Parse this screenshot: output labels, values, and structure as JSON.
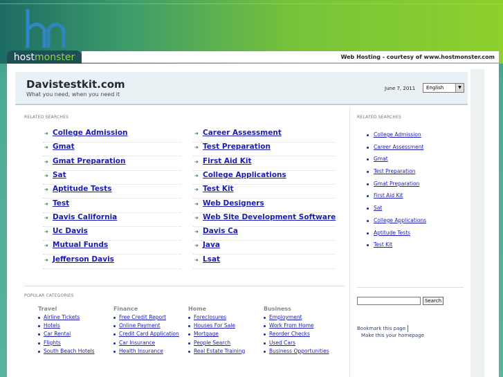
{
  "brand": {
    "host": "host",
    "monster": "monster"
  },
  "courtesy": "Web Hosting - courtesy of www.hostmonster.com",
  "header": {
    "title": "Davistestkit.com",
    "tagline": "What you need, when you need it",
    "date": "June 7, 2011",
    "language": "English"
  },
  "related_label": "RELATED SEARCHES",
  "keywords": [
    "College Admission",
    "Career Assessment",
    "Gmat",
    "Test Preparation",
    "Gmat Preparation",
    "First Aid Kit",
    "Sat",
    "College Applications",
    "Aptitude Tests",
    "Test Kit",
    "Test",
    "Web Designers",
    "Davis California",
    "Web Site Development Software",
    "Uc Davis",
    "Davis Ca",
    "Mutual Funds",
    "Java",
    "Jefferson Davis",
    "Lsat"
  ],
  "popular_label": "POPULAR CATEGORIES",
  "categories": [
    {
      "head": "Travel",
      "links": [
        "Airline Tickets",
        "Hotels",
        "Car Rental",
        "Flights",
        "South Beach Hotels"
      ]
    },
    {
      "head": "Finance",
      "links": [
        "Free Credit Report",
        "Online Payment",
        "Credit Card Application",
        "Car Insurance",
        "Health Insurance"
      ]
    },
    {
      "head": "Home",
      "links": [
        "Foreclosures",
        "Houses For Sale",
        "Mortgage",
        "People Search",
        "Real Estate Training"
      ]
    },
    {
      "head": "Business",
      "links": [
        "Employment",
        "Work From Home",
        "Reorder Checks",
        "Used Cars",
        "Business Opportunities"
      ]
    }
  ],
  "sidebar": {
    "label": "RELATED SEARCHES",
    "items": [
      "College Admission",
      "Career Assessment",
      "Gmat",
      "Test Preparation",
      "Gmat Preparation",
      "First Aid Kit",
      "Sat",
      "College Applications",
      "Aptitude Tests",
      "Test Kit"
    ],
    "search_button": "Search",
    "bookmark": "Bookmark this page",
    "homepage": "Make this your homepage"
  },
  "colors": {
    "link": "#1a1bb3",
    "accent": "#8ed12d"
  }
}
